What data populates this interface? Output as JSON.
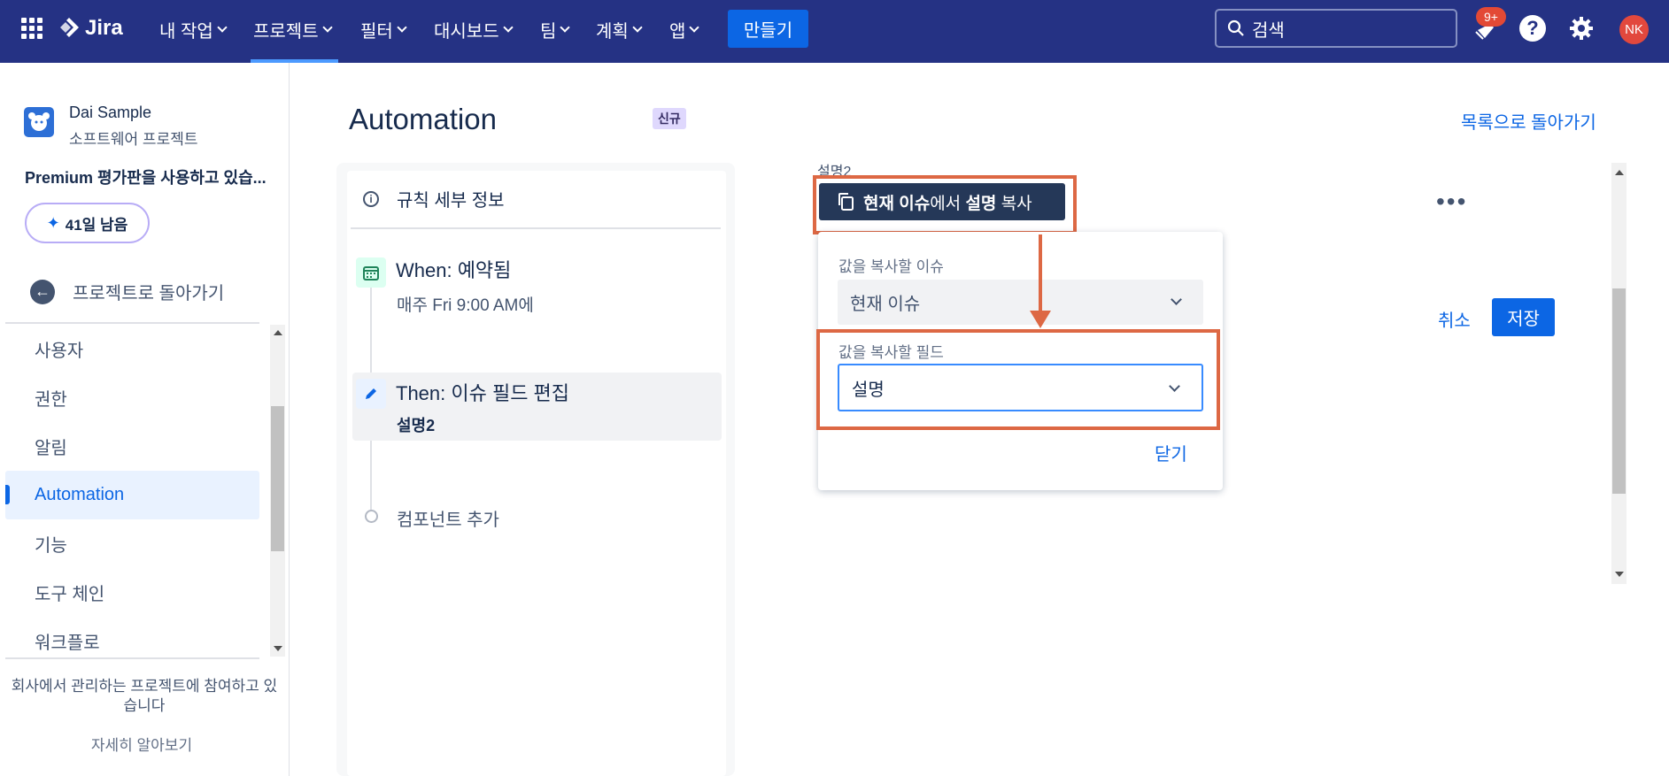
{
  "nav": {
    "logo": "Jira",
    "items": [
      {
        "label": "내 작업"
      },
      {
        "label": "프로젝트"
      },
      {
        "label": "필터"
      },
      {
        "label": "대시보드"
      },
      {
        "label": "팀"
      },
      {
        "label": "계획"
      },
      {
        "label": "앱"
      }
    ],
    "create_label": "만들기",
    "search_placeholder": "검색",
    "notification_badge": "9+",
    "help_label": "?",
    "avatar_initials": "NK",
    "accent_color": "#253284"
  },
  "sidebar": {
    "project_name": "Dai Sample",
    "project_type": "소프트웨어 프로젝트",
    "premium_text": "Premium 평가판을 사용하고 있습...",
    "days_left": "41일 남음",
    "back_label": "프로젝트로 돌아가기",
    "items": [
      {
        "label": "사용자"
      },
      {
        "label": "권한"
      },
      {
        "label": "알림"
      },
      {
        "label": "Automation"
      },
      {
        "label": "기능"
      },
      {
        "label": "도구 체인"
      },
      {
        "label": "워크플로"
      }
    ],
    "footer_text": "회사에서 관리하는 프로젝트에 참여하고 있습니다",
    "learn_more": "자세히 알아보기"
  },
  "main": {
    "title": "Automation",
    "new_badge": "신규",
    "back_to_list": "목록으로 돌아가기",
    "rule_details": "규칙 세부 정보",
    "when_title": "When: 예약됨",
    "when_sub": "매주 Fri 9:00 AM에",
    "then_title": "Then: 이슈 필드 편집",
    "then_sub": "설명2",
    "add_component": "컴포넌트 추가"
  },
  "config": {
    "field_label": "설명2",
    "smart_value_bold1": "현재 이슈",
    "smart_value_mid": "에서 ",
    "smart_value_bold2": "설명",
    "smart_value_end": " 복사",
    "more_label": "•••",
    "cancel_label": "취소",
    "save_label": "저장",
    "popup": {
      "issue_label": "값을 복사할 이슈",
      "issue_value": "현재 이슈",
      "field_label": "값을 복사할 필드",
      "field_value": "설명",
      "close_label": "닫기"
    },
    "highlight_color": "#dd6844"
  }
}
